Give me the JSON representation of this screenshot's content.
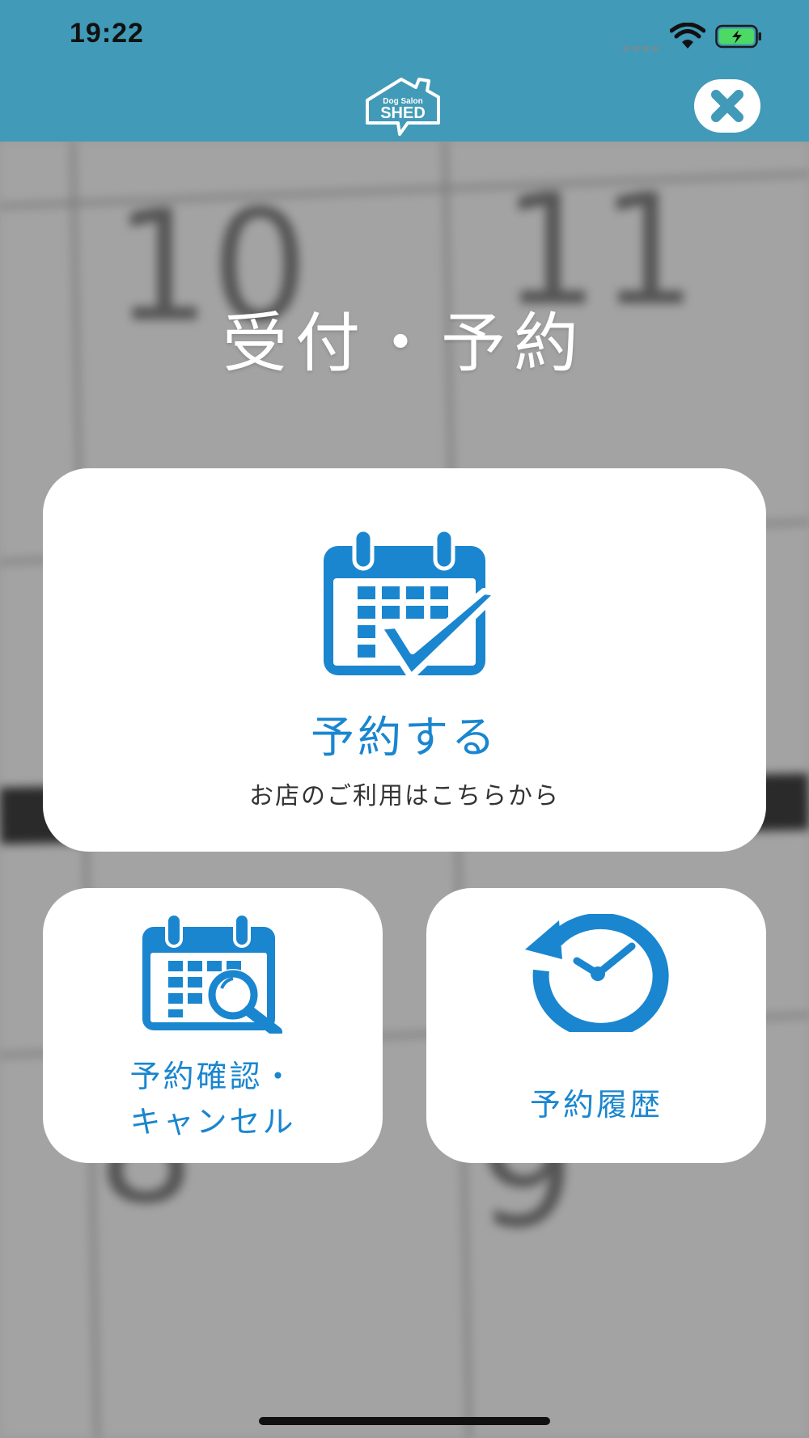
{
  "status_bar": {
    "time": "19:22"
  },
  "header": {
    "logo_text_top": "Dog Salon",
    "logo_text_main": "SHED",
    "close_icon": "close-icon"
  },
  "page": {
    "title": "受付・予約"
  },
  "actions": {
    "reserve": {
      "icon": "calendar-check-icon",
      "label": "予約する",
      "subtitle": "お店のご利用はこちらから"
    },
    "confirm_cancel": {
      "icon": "calendar-search-icon",
      "label_line1": "予約確認・",
      "label_line2": "キャンセル"
    },
    "history": {
      "icon": "history-clock-icon",
      "label": "予約履歴"
    }
  },
  "colors": {
    "header_bg": "#419ab7",
    "accent": "#1a86cf",
    "card_bg": "#ffffff"
  }
}
